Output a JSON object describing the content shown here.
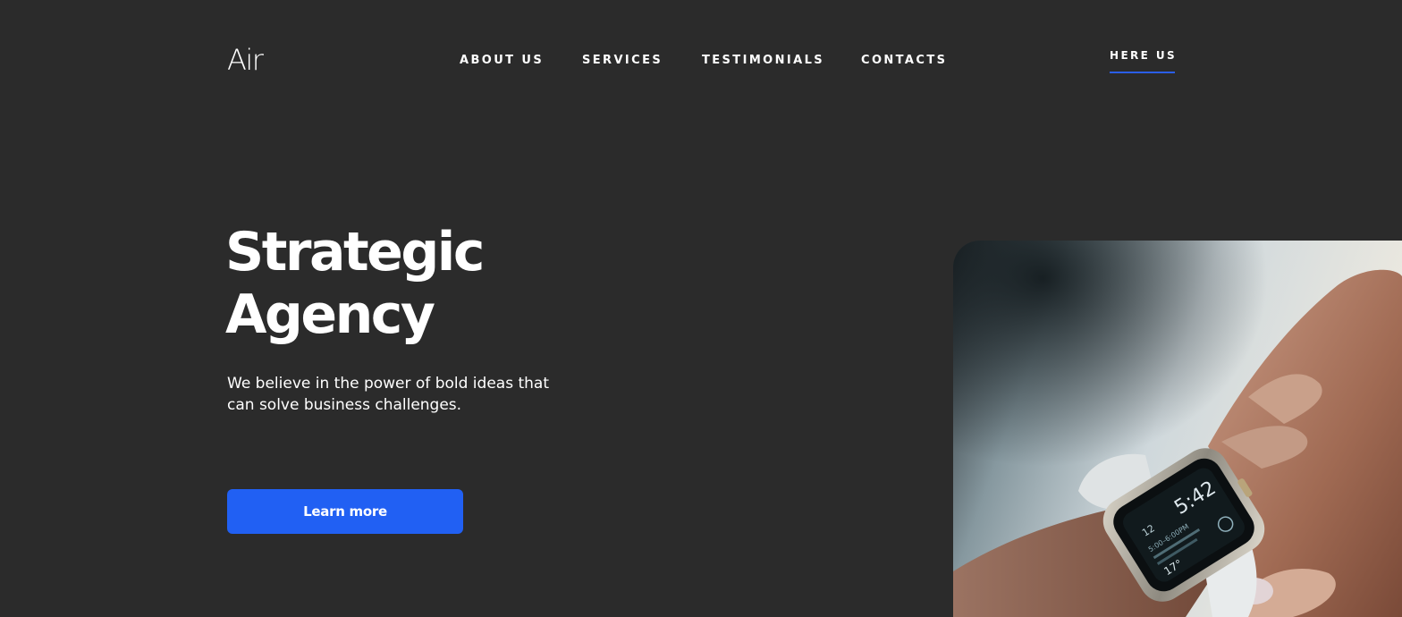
{
  "header": {
    "logo": "Air",
    "nav": [
      {
        "label": "ABOUT US"
      },
      {
        "label": "SERVICES"
      },
      {
        "label": "TESTIMONIALS"
      },
      {
        "label": "CONTACTS"
      }
    ],
    "cta_label": "HERE US"
  },
  "hero": {
    "title_line1": "Strategic",
    "title_line2": "Agency",
    "text_line1": "We believe in the power of bold ideas that",
    "text_line2": "can solve business challenges.",
    "button_label": "Learn more",
    "image": {
      "icon": "smartwatch-photo",
      "watch_time": "5:42",
      "watch_date": "12",
      "watch_event": "5:00–6:00PM",
      "watch_temp": "17°"
    }
  },
  "colors": {
    "background": "#2b2b2b",
    "accent": "#2160f3",
    "text": "#ffffff"
  }
}
